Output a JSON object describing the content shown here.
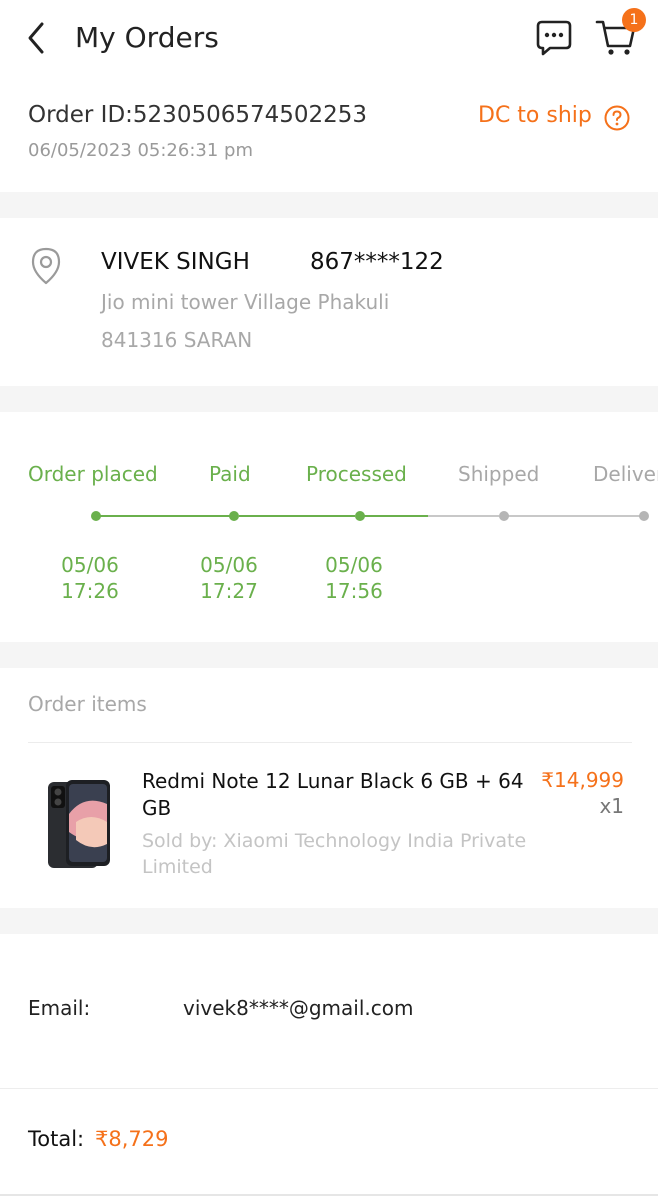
{
  "header": {
    "title": "My Orders",
    "back_icon": "chevron-left-icon",
    "chat_icon": "chat-bubble-icon",
    "cart_icon": "cart-icon",
    "cart_count": "1"
  },
  "order": {
    "id_text": "Order ID:5230506574502253",
    "date": "06/05/2023 05:26:31 pm",
    "status": "DC to ship",
    "help_icon": "question-circle-icon"
  },
  "address": {
    "icon": "location-pin-icon",
    "name": "VIVEK SINGH",
    "phone": "867****122",
    "line1": "Jio mini tower Village Phakuli",
    "line2": "841316 SARAN"
  },
  "progress": {
    "steps": [
      {
        "label": "Order placed",
        "date": "05/06",
        "time": "17:26",
        "done": true
      },
      {
        "label": "Paid",
        "date": "05/06",
        "time": "17:27",
        "done": true
      },
      {
        "label": "Processed",
        "date": "05/06",
        "time": "17:56",
        "done": true
      },
      {
        "label": "Shipped",
        "date": "",
        "time": "",
        "done": false
      },
      {
        "label": "Delivered",
        "date": "",
        "time": "",
        "done": false
      }
    ]
  },
  "items": {
    "title": "Order items",
    "list": [
      {
        "name": "Redmi Note 12 Lunar Black 6 GB + 64 GB",
        "seller": "Sold by: Xiaomi Technology India Private Limited",
        "price": "₹14,999",
        "qty": "x1"
      }
    ]
  },
  "contact": {
    "email_label": "Email:",
    "email_value": "vivek8****@gmail.com"
  },
  "summary": {
    "total_label": "Total:",
    "total_value": "₹8,729"
  },
  "colors": {
    "accent": "#f5711a",
    "progress_done": "#6ab04c",
    "progress_todo": "#b5b5b5",
    "section_gap": "#f5f5f5"
  }
}
